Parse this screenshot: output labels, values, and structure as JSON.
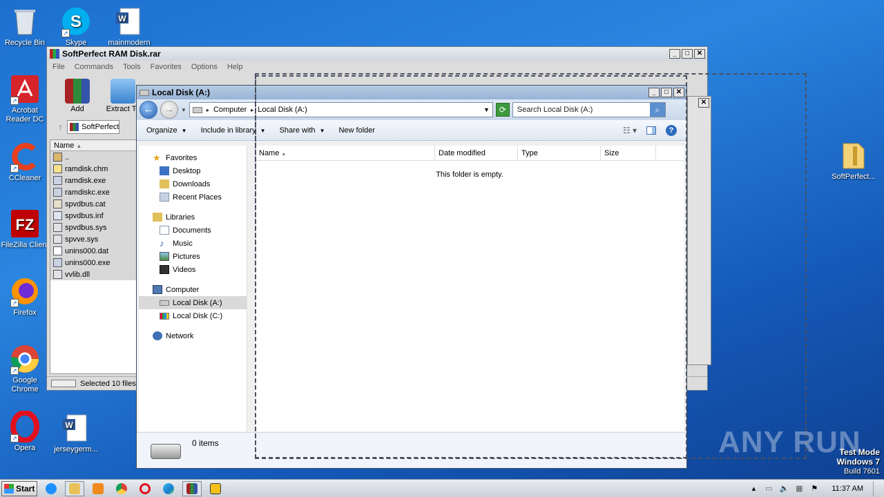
{
  "desktop": {
    "icons_left": [
      {
        "label": "Recycle Bin",
        "icon": "recycle-bin-icon"
      },
      {
        "label": "Skype",
        "icon": "skype-icon"
      },
      {
        "label": "mainmodern",
        "icon": "word-document-icon"
      },
      {
        "label": "Acrobat Reader DC",
        "icon": "acrobat-icon"
      },
      {
        "label": "CCleaner",
        "icon": "ccleaner-icon"
      },
      {
        "label": "FileZilla Client",
        "icon": "filezilla-icon"
      },
      {
        "label": "Firefox",
        "icon": "firefox-icon"
      },
      {
        "label": "Google Chrome",
        "icon": "chrome-icon"
      },
      {
        "label": "Opera",
        "icon": "opera-icon"
      },
      {
        "label": "jerseygerm...",
        "icon": "word-document-icon"
      }
    ],
    "icon_right": {
      "label": "SoftPerfect...",
      "icon": "zip-folder-icon"
    }
  },
  "winrar": {
    "title": "SoftPerfect RAM Disk.rar",
    "menu": [
      "File",
      "Commands",
      "Tools",
      "Favorites",
      "Options",
      "Help"
    ],
    "tools": [
      {
        "label": "Add"
      },
      {
        "label": "Extract To"
      }
    ],
    "path": "SoftPerfect",
    "column_name": "Name",
    "files": [
      "..",
      "ramdisk.chm",
      "ramdisk.exe",
      "ramdiskc.exe",
      "spvdbus.cat",
      "spvdbus.inf",
      "spvdbus.sys",
      "spvve.sys",
      "unins000.dat",
      "unins000.exe",
      "vvlib.dll"
    ],
    "status": "Selected 10 files,"
  },
  "explorer": {
    "title": "Local Disk (A:)",
    "address": {
      "root": "Computer",
      "current": "Local Disk (A:)"
    },
    "search_placeholder": "Search Local Disk (A:)",
    "commands": {
      "organize": "Organize",
      "include": "Include in library",
      "share": "Share with",
      "new_folder": "New folder"
    },
    "nav": {
      "favorites": "Favorites",
      "favorites_items": [
        "Desktop",
        "Downloads",
        "Recent Places"
      ],
      "libraries": "Libraries",
      "libraries_items": [
        "Documents",
        "Music",
        "Pictures",
        "Videos"
      ],
      "computer": "Computer",
      "computer_items": [
        "Local Disk (A:)",
        "Local Disk (C:)"
      ],
      "network": "Network"
    },
    "columns": [
      "Name",
      "Date modified",
      "Type",
      "Size"
    ],
    "empty_text": "This folder is empty.",
    "item_count": "0 items"
  },
  "watermark": {
    "text": "ANY RUN"
  },
  "testmode": {
    "line1": "Test Mode",
    "line2": "Windows 7",
    "line3": "Build 7601"
  },
  "taskbar": {
    "start": "Start",
    "clock": "11:37 AM"
  },
  "colors": {
    "accent": "#1d6fcf",
    "selection": "#d9d9d9"
  }
}
